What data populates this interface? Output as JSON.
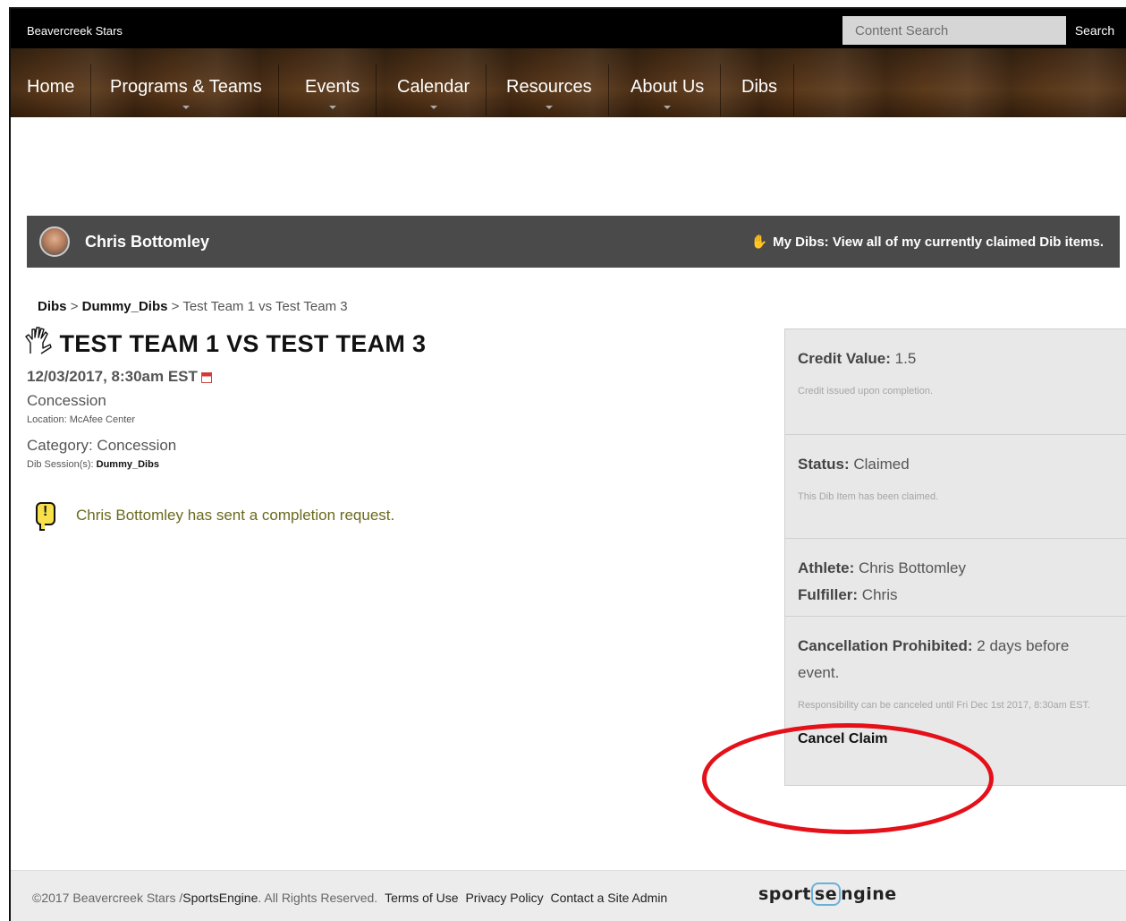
{
  "topbar": {
    "site_name": "Beavercreek Stars",
    "search_placeholder": "Content Search",
    "search_button": "Search"
  },
  "nav": {
    "items": [
      {
        "label": "Home"
      },
      {
        "label": "Programs & Teams"
      },
      {
        "label": "Events"
      },
      {
        "label": "Calendar"
      },
      {
        "label": "Resources"
      },
      {
        "label": "About Us"
      },
      {
        "label": "Dibs"
      }
    ]
  },
  "userbar": {
    "name": "Chris Bottomley",
    "my_dibs": "My Dibs: View all of my currently claimed Dib items."
  },
  "breadcrumb": {
    "root": "Dibs",
    "sep1": ">",
    "session": "Dummy_Dibs",
    "sep2": ">",
    "current": "Test Team 1 vs Test Team 3"
  },
  "item": {
    "title": "TEST TEAM 1 VS TEST TEAM 3",
    "datetime": "12/03/2017, 8:30am EST",
    "type": "Concession",
    "location": "Location: McAfee Center",
    "category": "Category: Concession",
    "session_label": "Dib Session(s):",
    "session_value": "Dummy_Dibs",
    "alert": "Chris Bottomley has sent a completion request."
  },
  "sidebar": {
    "credit_label": "Credit Value:",
    "credit_value": "1.5",
    "credit_note": "Credit issued upon completion.",
    "status_label": "Status:",
    "status_value": "Claimed",
    "status_note": "This Dib Item has been claimed.",
    "athlete_label": "Athlete:",
    "athlete_value": "Chris Bottomley",
    "fulfiller_label": "Fulfiller:",
    "fulfiller_value": "Chris",
    "cancel_label": "Cancellation Prohibited:",
    "cancel_value": "2 days before event.",
    "cancel_note": "Responsibility can be canceled until Fri Dec 1st 2017, 8:30am EST.",
    "cancel_link": "Cancel Claim"
  },
  "annotation": {
    "color": "#e4111a"
  },
  "footer": {
    "copyright": "©2017 Beavercreek Stars /",
    "sportsengine": "SportsEngine",
    "rights": ". All Rights Reserved.",
    "terms": "Terms of Use",
    "privacy": "Privacy Policy",
    "contact": "Contact a Site Admin",
    "brand_pre": "sport",
    "brand_hl": "se",
    "brand_post": "ngine"
  }
}
